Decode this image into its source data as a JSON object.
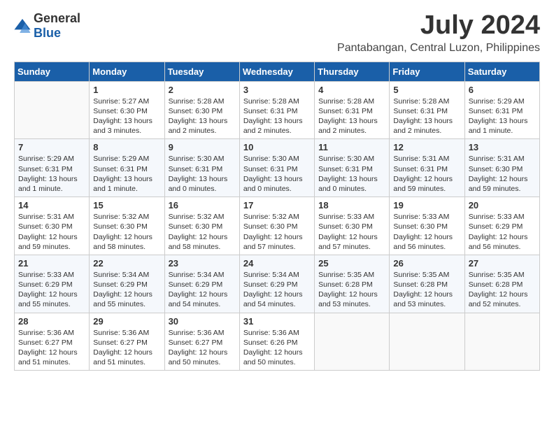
{
  "header": {
    "logo_general": "General",
    "logo_blue": "Blue",
    "month_year": "July 2024",
    "location": "Pantabangan, Central Luzon, Philippines"
  },
  "weekdays": [
    "Sunday",
    "Monday",
    "Tuesday",
    "Wednesday",
    "Thursday",
    "Friday",
    "Saturday"
  ],
  "weeks": [
    [
      {
        "day": "",
        "sunrise": "",
        "sunset": "",
        "daylight": ""
      },
      {
        "day": "1",
        "sunrise": "Sunrise: 5:27 AM",
        "sunset": "Sunset: 6:30 PM",
        "daylight": "Daylight: 13 hours and 3 minutes."
      },
      {
        "day": "2",
        "sunrise": "Sunrise: 5:28 AM",
        "sunset": "Sunset: 6:30 PM",
        "daylight": "Daylight: 13 hours and 2 minutes."
      },
      {
        "day": "3",
        "sunrise": "Sunrise: 5:28 AM",
        "sunset": "Sunset: 6:31 PM",
        "daylight": "Daylight: 13 hours and 2 minutes."
      },
      {
        "day": "4",
        "sunrise": "Sunrise: 5:28 AM",
        "sunset": "Sunset: 6:31 PM",
        "daylight": "Daylight: 13 hours and 2 minutes."
      },
      {
        "day": "5",
        "sunrise": "Sunrise: 5:28 AM",
        "sunset": "Sunset: 6:31 PM",
        "daylight": "Daylight: 13 hours and 2 minutes."
      },
      {
        "day": "6",
        "sunrise": "Sunrise: 5:29 AM",
        "sunset": "Sunset: 6:31 PM",
        "daylight": "Daylight: 13 hours and 1 minute."
      }
    ],
    [
      {
        "day": "7",
        "sunrise": "Sunrise: 5:29 AM",
        "sunset": "Sunset: 6:31 PM",
        "daylight": "Daylight: 13 hours and 1 minute."
      },
      {
        "day": "8",
        "sunrise": "Sunrise: 5:29 AM",
        "sunset": "Sunset: 6:31 PM",
        "daylight": "Daylight: 13 hours and 1 minute."
      },
      {
        "day": "9",
        "sunrise": "Sunrise: 5:30 AM",
        "sunset": "Sunset: 6:31 PM",
        "daylight": "Daylight: 13 hours and 0 minutes."
      },
      {
        "day": "10",
        "sunrise": "Sunrise: 5:30 AM",
        "sunset": "Sunset: 6:31 PM",
        "daylight": "Daylight: 13 hours and 0 minutes."
      },
      {
        "day": "11",
        "sunrise": "Sunrise: 5:30 AM",
        "sunset": "Sunset: 6:31 PM",
        "daylight": "Daylight: 13 hours and 0 minutes."
      },
      {
        "day": "12",
        "sunrise": "Sunrise: 5:31 AM",
        "sunset": "Sunset: 6:31 PM",
        "daylight": "Daylight: 12 hours and 59 minutes."
      },
      {
        "day": "13",
        "sunrise": "Sunrise: 5:31 AM",
        "sunset": "Sunset: 6:30 PM",
        "daylight": "Daylight: 12 hours and 59 minutes."
      }
    ],
    [
      {
        "day": "14",
        "sunrise": "Sunrise: 5:31 AM",
        "sunset": "Sunset: 6:30 PM",
        "daylight": "Daylight: 12 hours and 59 minutes."
      },
      {
        "day": "15",
        "sunrise": "Sunrise: 5:32 AM",
        "sunset": "Sunset: 6:30 PM",
        "daylight": "Daylight: 12 hours and 58 minutes."
      },
      {
        "day": "16",
        "sunrise": "Sunrise: 5:32 AM",
        "sunset": "Sunset: 6:30 PM",
        "daylight": "Daylight: 12 hours and 58 minutes."
      },
      {
        "day": "17",
        "sunrise": "Sunrise: 5:32 AM",
        "sunset": "Sunset: 6:30 PM",
        "daylight": "Daylight: 12 hours and 57 minutes."
      },
      {
        "day": "18",
        "sunrise": "Sunrise: 5:33 AM",
        "sunset": "Sunset: 6:30 PM",
        "daylight": "Daylight: 12 hours and 57 minutes."
      },
      {
        "day": "19",
        "sunrise": "Sunrise: 5:33 AM",
        "sunset": "Sunset: 6:30 PM",
        "daylight": "Daylight: 12 hours and 56 minutes."
      },
      {
        "day": "20",
        "sunrise": "Sunrise: 5:33 AM",
        "sunset": "Sunset: 6:29 PM",
        "daylight": "Daylight: 12 hours and 56 minutes."
      }
    ],
    [
      {
        "day": "21",
        "sunrise": "Sunrise: 5:33 AM",
        "sunset": "Sunset: 6:29 PM",
        "daylight": "Daylight: 12 hours and 55 minutes."
      },
      {
        "day": "22",
        "sunrise": "Sunrise: 5:34 AM",
        "sunset": "Sunset: 6:29 PM",
        "daylight": "Daylight: 12 hours and 55 minutes."
      },
      {
        "day": "23",
        "sunrise": "Sunrise: 5:34 AM",
        "sunset": "Sunset: 6:29 PM",
        "daylight": "Daylight: 12 hours and 54 minutes."
      },
      {
        "day": "24",
        "sunrise": "Sunrise: 5:34 AM",
        "sunset": "Sunset: 6:29 PM",
        "daylight": "Daylight: 12 hours and 54 minutes."
      },
      {
        "day": "25",
        "sunrise": "Sunrise: 5:35 AM",
        "sunset": "Sunset: 6:28 PM",
        "daylight": "Daylight: 12 hours and 53 minutes."
      },
      {
        "day": "26",
        "sunrise": "Sunrise: 5:35 AM",
        "sunset": "Sunset: 6:28 PM",
        "daylight": "Daylight: 12 hours and 53 minutes."
      },
      {
        "day": "27",
        "sunrise": "Sunrise: 5:35 AM",
        "sunset": "Sunset: 6:28 PM",
        "daylight": "Daylight: 12 hours and 52 minutes."
      }
    ],
    [
      {
        "day": "28",
        "sunrise": "Sunrise: 5:36 AM",
        "sunset": "Sunset: 6:27 PM",
        "daylight": "Daylight: 12 hours and 51 minutes."
      },
      {
        "day": "29",
        "sunrise": "Sunrise: 5:36 AM",
        "sunset": "Sunset: 6:27 PM",
        "daylight": "Daylight: 12 hours and 51 minutes."
      },
      {
        "day": "30",
        "sunrise": "Sunrise: 5:36 AM",
        "sunset": "Sunset: 6:27 PM",
        "daylight": "Daylight: 12 hours and 50 minutes."
      },
      {
        "day": "31",
        "sunrise": "Sunrise: 5:36 AM",
        "sunset": "Sunset: 6:26 PM",
        "daylight": "Daylight: 12 hours and 50 minutes."
      },
      {
        "day": "",
        "sunrise": "",
        "sunset": "",
        "daylight": ""
      },
      {
        "day": "",
        "sunrise": "",
        "sunset": "",
        "daylight": ""
      },
      {
        "day": "",
        "sunrise": "",
        "sunset": "",
        "daylight": ""
      }
    ]
  ]
}
